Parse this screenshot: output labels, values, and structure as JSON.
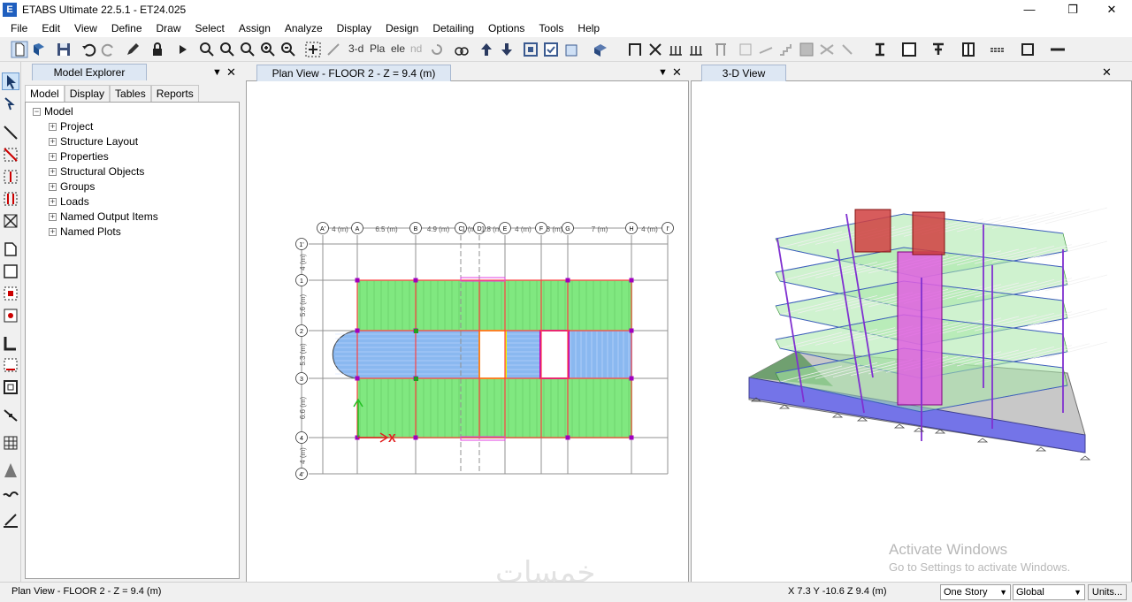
{
  "window": {
    "title": "ETABS Ultimate 22.5.1 - ET24.025",
    "logo_letter": "E",
    "minimize": "—",
    "restore": "❐",
    "close": "✕"
  },
  "menu": [
    "File",
    "Edit",
    "View",
    "Define",
    "Draw",
    "Select",
    "Assign",
    "Analyze",
    "Display",
    "Design",
    "Detailing",
    "Options",
    "Tools",
    "Help"
  ],
  "toolbar": {
    "view_3d": "3-d",
    "view_pla": "Pla",
    "view_ele": "ele",
    "view_nd": "nd"
  },
  "explorer": {
    "title": "Model Explorer",
    "tabs": [
      "Model",
      "Display",
      "Tables",
      "Reports"
    ],
    "active_tab": "Model",
    "root": "Model",
    "items": [
      "Project",
      "Structure Layout",
      "Properties",
      "Structural Objects",
      "Groups",
      "Loads",
      "Named Output Items",
      "Named Plots"
    ]
  },
  "plan_view": {
    "tab": "Plan View - FLOOR 2 - Z = 9.4 (m)",
    "grid_x": [
      {
        "id": "A'",
        "spacing_after": "4 (m)"
      },
      {
        "id": "A",
        "spacing_after": "6.5 (m)"
      },
      {
        "id": "B",
        "spacing_after": "4.9 (m)"
      },
      {
        "id": "C",
        "spacing_after": "1 (m)"
      },
      {
        "id": "D",
        "spacing_after": "1.8 (m)"
      },
      {
        "id": "E",
        "spacing_after": "4 (m)"
      },
      {
        "id": "F",
        "spacing_after": "3 (m)"
      },
      {
        "id": "G",
        "spacing_after": "7 (m)"
      },
      {
        "id": "H",
        "spacing_after": "4 (m)"
      },
      {
        "id": "I'",
        "spacing_after": ""
      }
    ],
    "grid_y": [
      {
        "id": "1'",
        "spacing_after": "4 (m)"
      },
      {
        "id": "1",
        "spacing_after": "5.6 (m)"
      },
      {
        "id": "2",
        "spacing_after": "5.3 (m)"
      },
      {
        "id": "3",
        "spacing_after": "6.6 (m)"
      },
      {
        "id": "4",
        "spacing_after": "4 (m)"
      },
      {
        "id": "4'",
        "spacing_after": ""
      }
    ],
    "axis_x_label": "X",
    "colors": {
      "slab": "#80e880",
      "deck": "#8ab8f0",
      "beam": "#ff4040",
      "column": "#a000c0",
      "grid": "#909090"
    }
  },
  "view_3d": {
    "tab": "3-D View"
  },
  "os_watermark": {
    "line1": "Activate Windows",
    "line2": "Go to Settings to activate Windows."
  },
  "brand_watermark": "خمسات",
  "status": {
    "left": "Plan View - FLOOR 2 - Z = 9.4 (m)",
    "coords": "X 7.3  Y -10.6  Z 9.4 (m)",
    "story_combo": "One Story",
    "coord_combo": "Global",
    "units": "Units..."
  }
}
